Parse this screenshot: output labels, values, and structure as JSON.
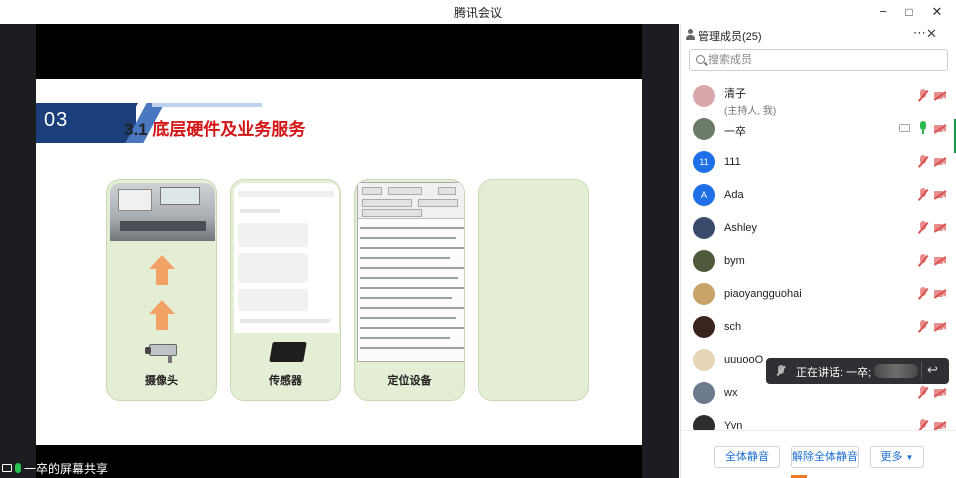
{
  "window": {
    "title": "腾讯会议",
    "controls": {
      "minimize": "−",
      "maximize": "□",
      "close": "✕"
    }
  },
  "share": {
    "sharer_label": "一卒的屏幕共享",
    "slide": {
      "section_number": "03",
      "heading_num": "3.1 ",
      "heading_text": "底层硬件及业务服务",
      "cards": [
        {
          "label": "摄像头"
        },
        {
          "label": "传感器"
        },
        {
          "label": "定位设备"
        },
        {
          "label": ""
        }
      ]
    }
  },
  "panel": {
    "title": "管理成员(25)",
    "more_icon": "⋯",
    "close_icon": "✕",
    "search_placeholder": "搜索成员",
    "members": [
      {
        "name": "清子",
        "sub": "(主持人, 我)",
        "avatar_text": "",
        "avatar_color": "#d9a6ac",
        "mic": "off",
        "cam": "off"
      },
      {
        "name": "一卒",
        "sub": "",
        "avatar_text": "",
        "avatar_color": "#6b7c68",
        "mic": "on",
        "cam": "off",
        "sharing": true
      },
      {
        "name": "111",
        "sub": "",
        "avatar_text": "11",
        "avatar_color": "#1f6fe8",
        "mic": "off",
        "cam": "off"
      },
      {
        "name": "Ada",
        "sub": "",
        "avatar_text": "A",
        "avatar_color": "#1f6fe8",
        "mic": "off",
        "cam": "off"
      },
      {
        "name": "Ashley",
        "sub": "",
        "avatar_text": "",
        "avatar_color": "#3a4a6b",
        "mic": "off",
        "cam": "off"
      },
      {
        "name": "bym",
        "sub": "",
        "avatar_text": "",
        "avatar_color": "#4f5a3a",
        "mic": "off",
        "cam": "off"
      },
      {
        "name": "piaoyangguohai",
        "sub": "",
        "avatar_text": "",
        "avatar_color": "#c8a36a",
        "mic": "off",
        "cam": "off"
      },
      {
        "name": "sch",
        "sub": "",
        "avatar_text": "",
        "avatar_color": "#3b2420",
        "mic": "off",
        "cam": "off"
      },
      {
        "name": "uuuooO",
        "sub": "",
        "avatar_text": "",
        "avatar_color": "#e9d6b8",
        "mic": "off",
        "cam": "off"
      },
      {
        "name": "wx",
        "sub": "",
        "avatar_text": "",
        "avatar_color": "#6c7a8e",
        "mic": "off",
        "cam": "off"
      },
      {
        "name": "Yvn",
        "sub": "",
        "avatar_text": "",
        "avatar_color": "#2d2d2d",
        "mic": "off",
        "cam": "off"
      }
    ],
    "speaking_label": "正在讲话: 一卒;",
    "buttons": {
      "mute_all": "全体静音",
      "unmute_all": "解除全体静音",
      "more": "更多"
    }
  },
  "colors": {
    "accent_blue": "#1f6fd1",
    "slide_navy": "#1b3f7a",
    "heading_red": "#d41414",
    "card_green": "#e3eed5",
    "mic_on": "#2fb84f",
    "mic_off": "#e88e8e"
  }
}
